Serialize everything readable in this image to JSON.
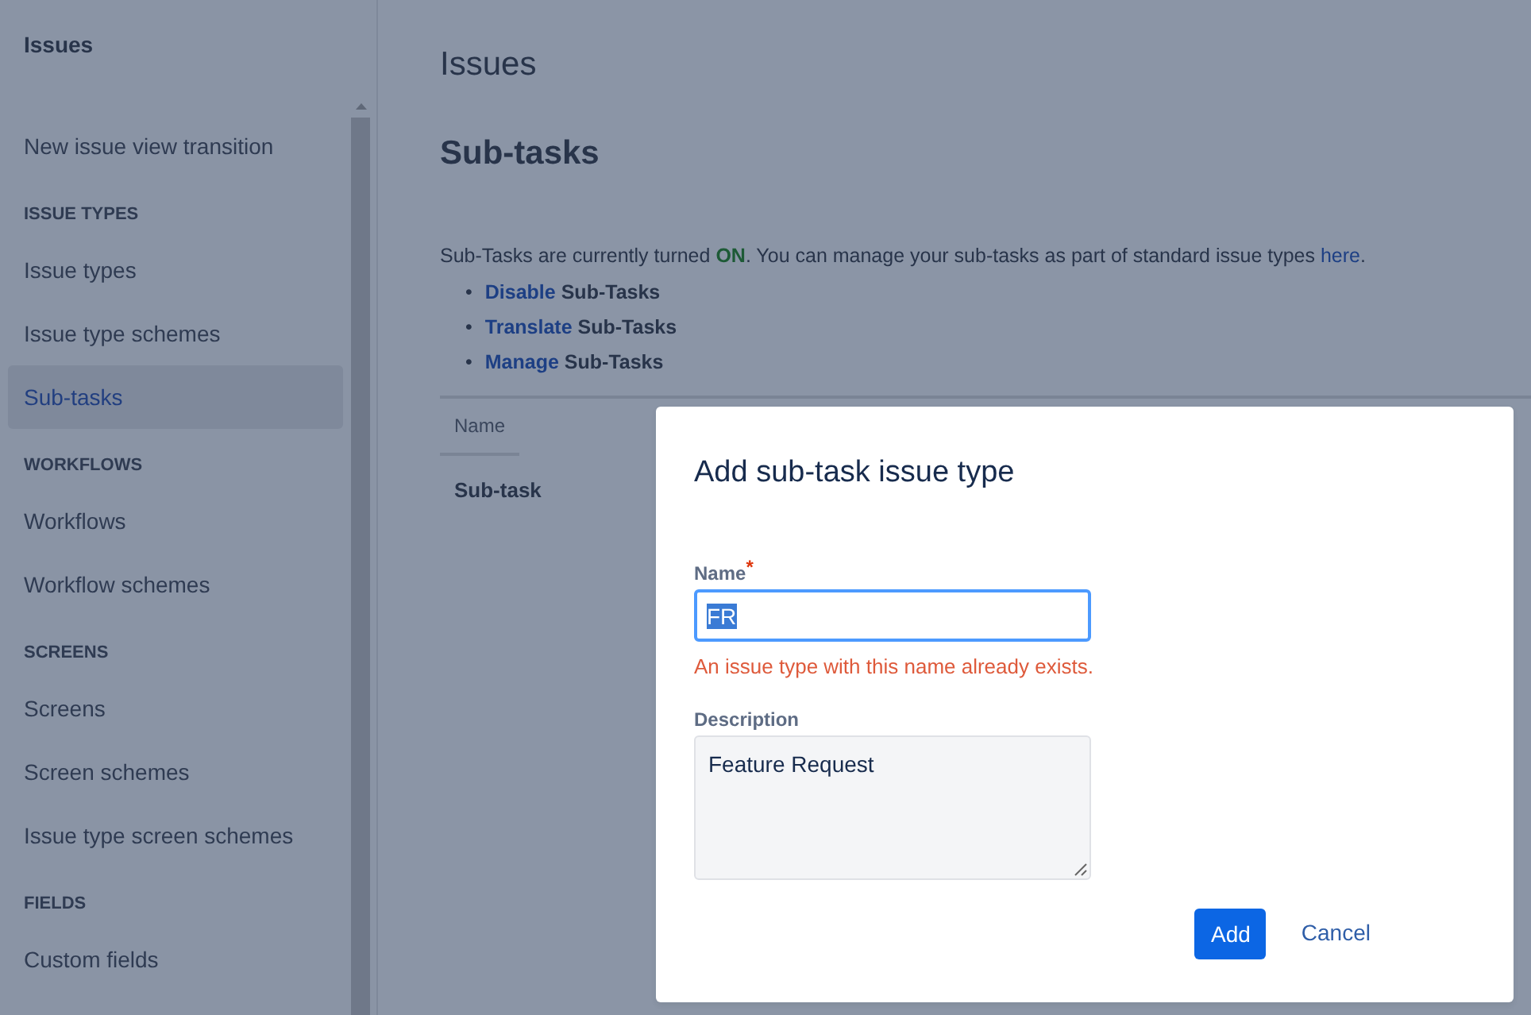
{
  "sidebar": {
    "title": "Issues",
    "items": [
      {
        "kind": "link",
        "label": "New issue view transition",
        "selected": false
      },
      {
        "kind": "heading",
        "label": "ISSUE TYPES"
      },
      {
        "kind": "link",
        "label": "Issue types",
        "selected": false
      },
      {
        "kind": "link",
        "label": "Issue type schemes",
        "selected": false
      },
      {
        "kind": "link",
        "label": "Sub-tasks",
        "selected": true
      },
      {
        "kind": "heading",
        "label": "WORKFLOWS"
      },
      {
        "kind": "link",
        "label": "Workflows",
        "selected": false
      },
      {
        "kind": "link",
        "label": "Workflow schemes",
        "selected": false
      },
      {
        "kind": "heading",
        "label": "SCREENS"
      },
      {
        "kind": "link",
        "label": "Screens",
        "selected": false
      },
      {
        "kind": "link",
        "label": "Screen schemes",
        "selected": false
      },
      {
        "kind": "link",
        "label": "Issue type screen schemes",
        "selected": false
      },
      {
        "kind": "heading",
        "label": "FIELDS"
      },
      {
        "kind": "link",
        "label": "Custom fields",
        "selected": false
      }
    ]
  },
  "page": {
    "title": "Issues",
    "subtitle": "Sub-tasks",
    "intro": {
      "before": "Sub-Tasks are currently turned ",
      "status": "ON",
      "after": ". You can manage your sub-tasks as part of standard issue types ",
      "link": "here",
      "end": "."
    },
    "actions": [
      {
        "bullet": "•",
        "link": "Disable",
        "text": "Sub-Tasks"
      },
      {
        "bullet": "•",
        "link": "Translate",
        "text": "Sub-Tasks"
      },
      {
        "bullet": "•",
        "link": "Manage",
        "text": "Sub-Tasks"
      }
    ],
    "table": {
      "columns": [
        "Name"
      ],
      "rows": [
        [
          "Sub-task"
        ]
      ]
    }
  },
  "dialog": {
    "title": "Add sub-task issue type",
    "fields": [
      {
        "kind": "input",
        "label": "Name",
        "required_mark": "*",
        "value": "FR",
        "text_selected": true,
        "focused": true,
        "error": "An issue type with this name already exists."
      },
      {
        "kind": "textarea",
        "label": "Description",
        "value": "Feature Request",
        "text_selected": false,
        "focused": false
      }
    ],
    "buttons": [
      {
        "kind": "primary",
        "label": "Add"
      },
      {
        "kind": "link",
        "label": "Cancel"
      }
    ]
  }
}
